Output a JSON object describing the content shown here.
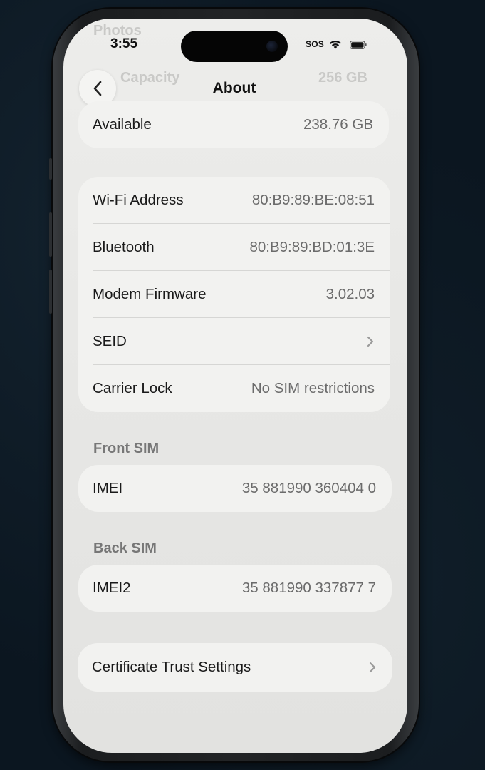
{
  "status_bar": {
    "time": "3:55",
    "sos": "SOS"
  },
  "ghost_text": {
    "photos": "Photos",
    "capacity": "Capacity",
    "capacity_value": "256 GB"
  },
  "nav": {
    "title": "About"
  },
  "storage_group": {
    "available_label": "Available",
    "available_value": "238.76 GB"
  },
  "network_group": {
    "rows": [
      {
        "label": "Wi-Fi Address",
        "value": "80:B9:89:BE:08:51"
      },
      {
        "label": "Bluetooth",
        "value": "80:B9:89:BD:01:3E"
      },
      {
        "label": "Modem Firmware",
        "value": "3.02.03"
      },
      {
        "label": "SEID",
        "value": ""
      },
      {
        "label": "Carrier Lock",
        "value": "No SIM restrictions"
      }
    ]
  },
  "front_sim": {
    "header": "Front SIM",
    "label": "IMEI",
    "value": "35 881990 360404 0"
  },
  "back_sim": {
    "header": "Back SIM",
    "label": "IMEI2",
    "value": "35 881990 337877 7"
  },
  "certificate": {
    "label": "Certificate Trust Settings"
  },
  "icons": {
    "back": "chevron-left-icon",
    "disclosure": "chevron-right-icon",
    "wifi": "wifi-icon",
    "battery": "battery-icon"
  }
}
